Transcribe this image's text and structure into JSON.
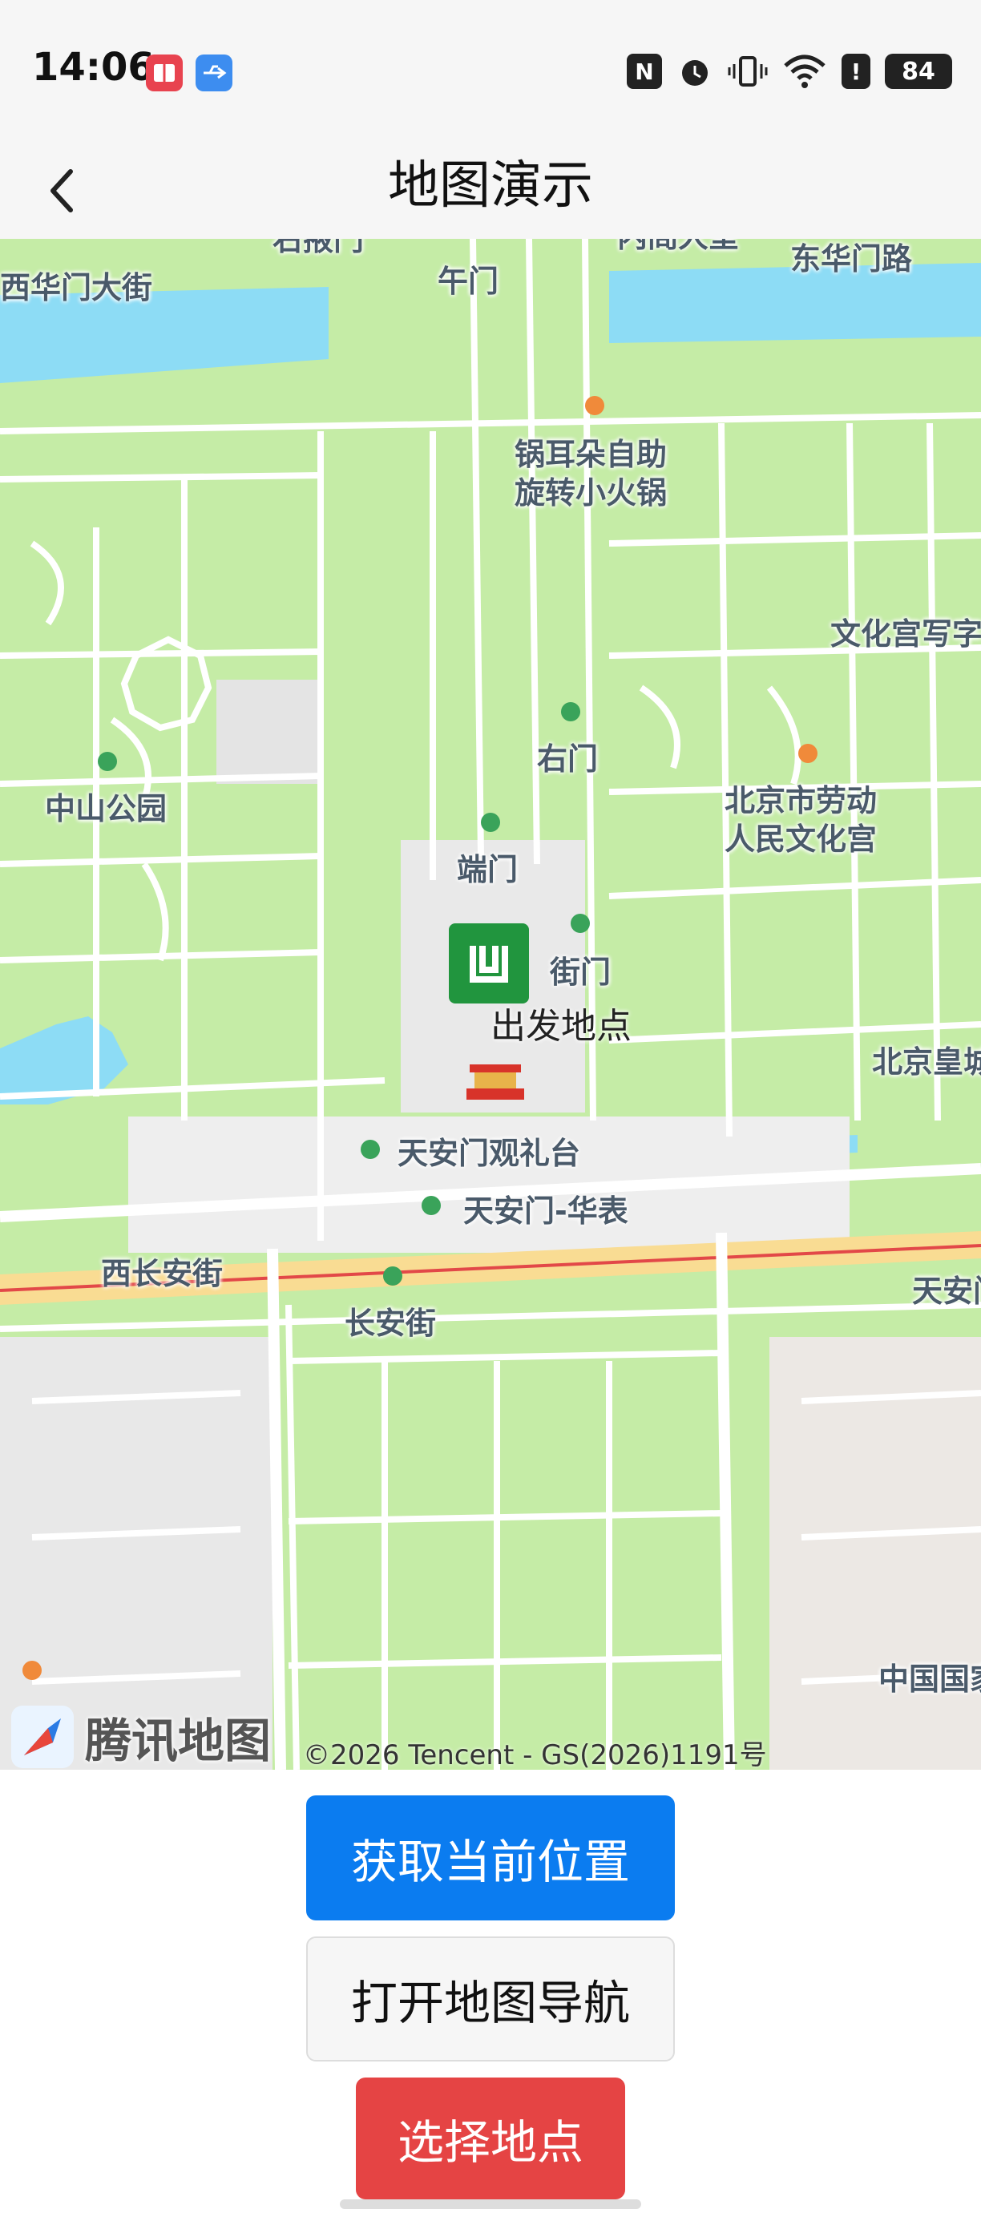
{
  "status_bar": {
    "time": "14:06",
    "battery": "84",
    "icons": [
      "book-app-icon",
      "usb-icon",
      "nfc-icon",
      "alarm-icon",
      "vibrate-icon",
      "wifi-icon",
      "alert-icon",
      "battery-icon"
    ]
  },
  "header": {
    "title": "地图演示",
    "back_icon": "chevron-left-icon"
  },
  "map": {
    "labels": [
      "西华门大街",
      "午门",
      "东华门路",
      "锅耳朵自助",
      "旋转小火锅",
      "文化宫写字",
      "右门",
      "中山公园",
      "北京市劳动",
      "人民文化宫",
      "端门",
      "街门",
      "北京皇城",
      "天安门观礼台",
      "天安门-华表",
      "西长安街",
      "长安街",
      "天安门",
      "中国国家",
      "内阁大堂",
      "右掖门"
    ],
    "marker_label": "出发地点",
    "brand": "腾讯地图",
    "copyright": "©2026 Tencent - GS(2026)1191号"
  },
  "actions": {
    "get_location": "获取当前位置",
    "open_navigation": "打开地图导航",
    "choose_place": "选择地点"
  },
  "colors": {
    "primary": "#0b7cf0",
    "danger": "#e54444",
    "map_green": "#c5eca6",
    "map_water": "#8ddcf5",
    "marker": "#21953e"
  }
}
